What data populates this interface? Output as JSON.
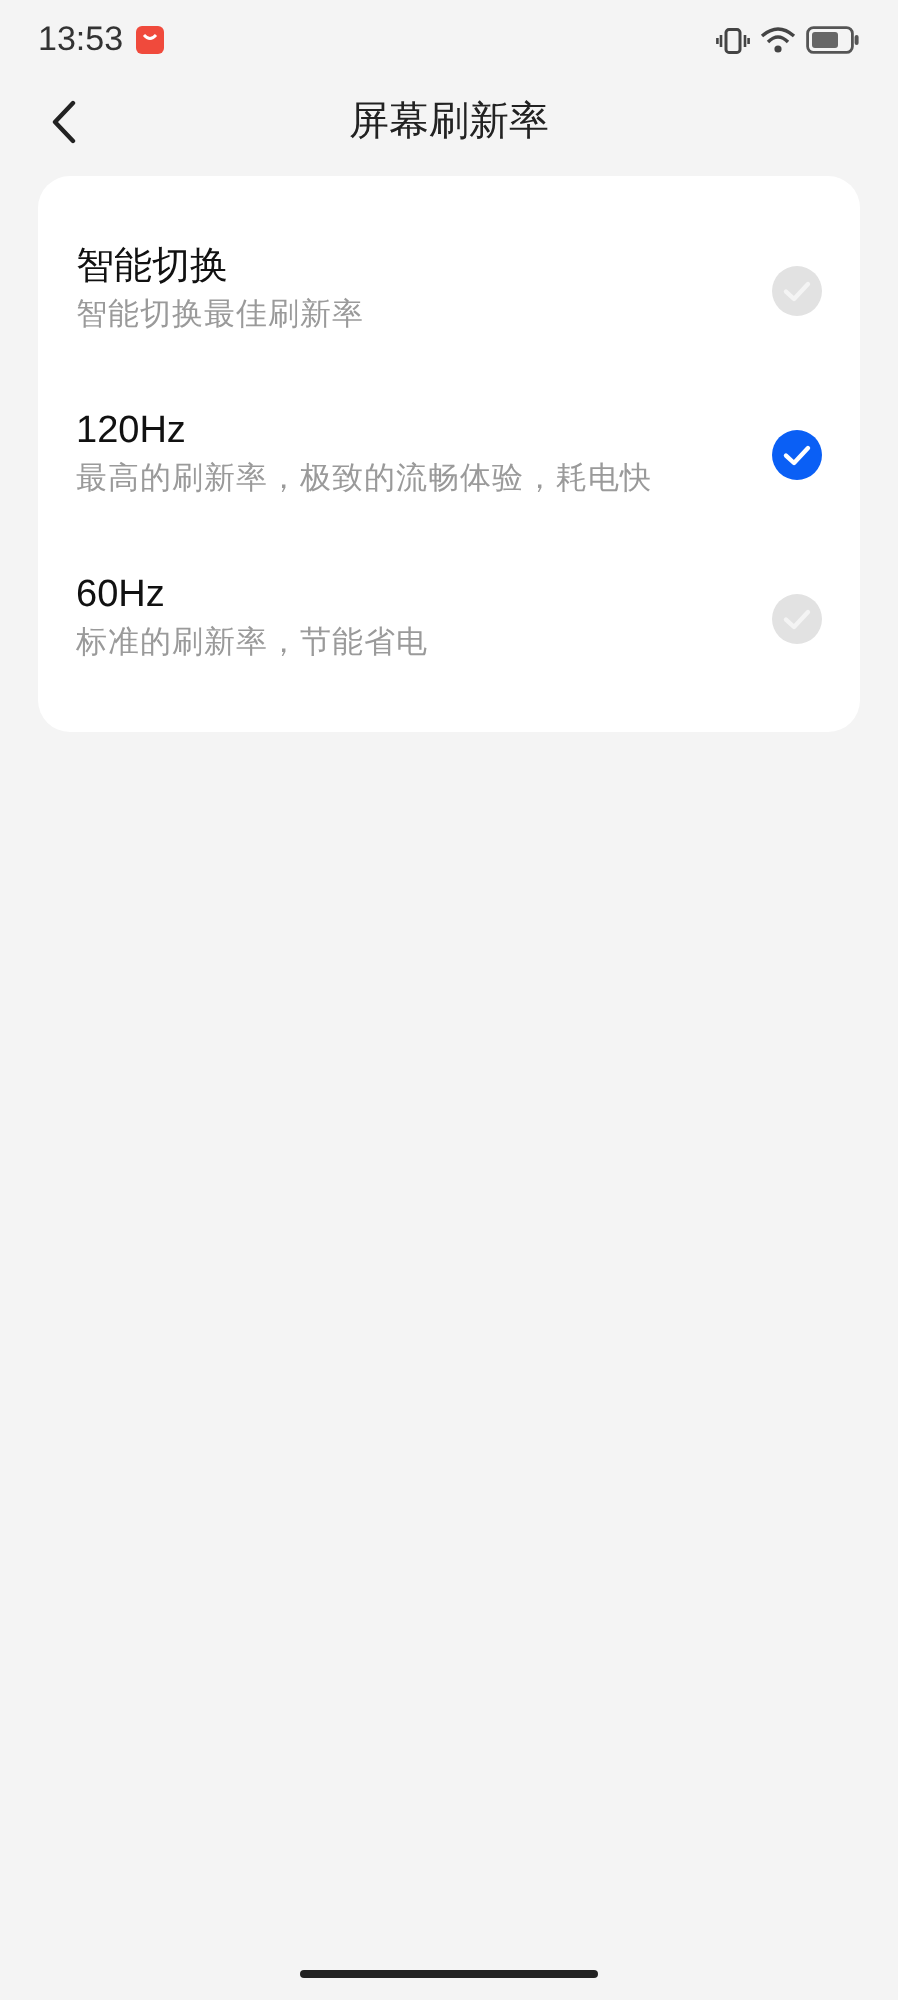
{
  "status_bar": {
    "time": "13:53"
  },
  "header": {
    "title": "屏幕刷新率"
  },
  "options": [
    {
      "title": "智能切换",
      "subtitle": "智能切换最佳刷新率",
      "selected": false
    },
    {
      "title": "120Hz",
      "subtitle": "最高的刷新率，极致的流畅体验，耗电快",
      "selected": true
    },
    {
      "title": "60Hz",
      "subtitle": "标准的刷新率，节能省电",
      "selected": false
    }
  ]
}
